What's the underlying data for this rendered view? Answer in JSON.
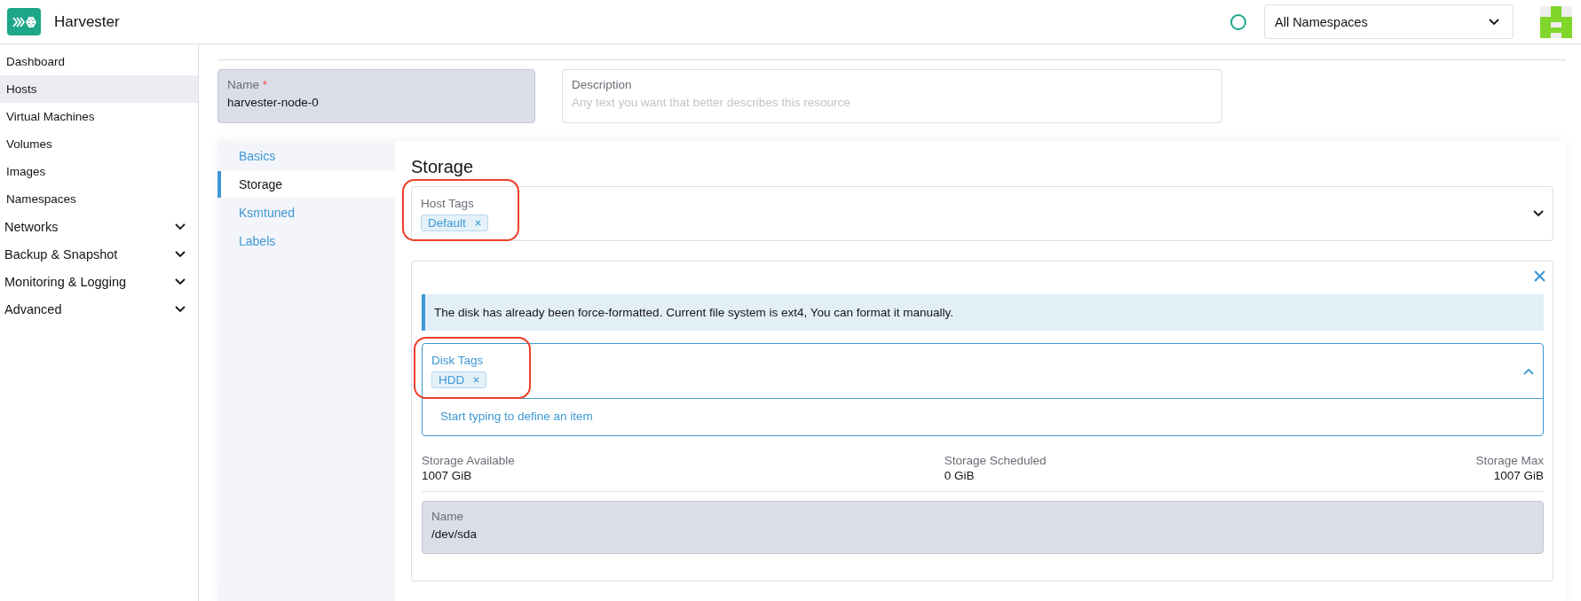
{
  "header": {
    "title": "Harvester",
    "namespace_select": {
      "value": "All Namespaces"
    }
  },
  "sidebar": {
    "items": [
      {
        "label": "Dashboard",
        "selected": false,
        "kind": "link"
      },
      {
        "label": "Hosts",
        "selected": true,
        "kind": "link"
      },
      {
        "label": "Virtual Machines",
        "selected": false,
        "kind": "link"
      },
      {
        "label": "Volumes",
        "selected": false,
        "kind": "link"
      },
      {
        "label": "Images",
        "selected": false,
        "kind": "link"
      },
      {
        "label": "Namespaces",
        "selected": false,
        "kind": "link"
      },
      {
        "label": "Networks",
        "selected": false,
        "kind": "group"
      },
      {
        "label": "Backup & Snapshot",
        "selected": false,
        "kind": "group"
      },
      {
        "label": "Monitoring & Logging",
        "selected": false,
        "kind": "group"
      },
      {
        "label": "Advanced",
        "selected": false,
        "kind": "group"
      }
    ]
  },
  "form": {
    "name": {
      "label": "Name",
      "required": true,
      "required_mark": "*",
      "value": "harvester-node-0",
      "disabled": true
    },
    "description": {
      "label": "Description",
      "placeholder": "Any text you want that better describes this resource"
    }
  },
  "tabs": [
    {
      "label": "Basics",
      "selected": false
    },
    {
      "label": "Storage",
      "selected": true
    },
    {
      "label": "Ksmtuned",
      "selected": false
    },
    {
      "label": "Labels",
      "selected": false
    }
  ],
  "storage": {
    "heading": "Storage",
    "host_tags": {
      "label": "Host Tags",
      "tags": [
        "Default"
      ],
      "expanded": false,
      "highlighted": true
    },
    "disk": {
      "banner": "The disk has already been force-formatted. Current file system is ext4, You can format it manually.",
      "disk_tags": {
        "label": "Disk Tags",
        "tags": [
          "HDD"
        ],
        "expanded": true,
        "highlighted": true,
        "hint": "Start typing to define an item"
      },
      "stats": [
        {
          "label": "Storage Available",
          "value": "1007 GiB"
        },
        {
          "label": "Storage Scheduled",
          "value": "0 GiB"
        },
        {
          "label": "Storage Max",
          "value": "1007 GiB"
        }
      ],
      "name": {
        "label": "Name",
        "value": "/dev/sda",
        "disabled": true
      }
    }
  }
}
